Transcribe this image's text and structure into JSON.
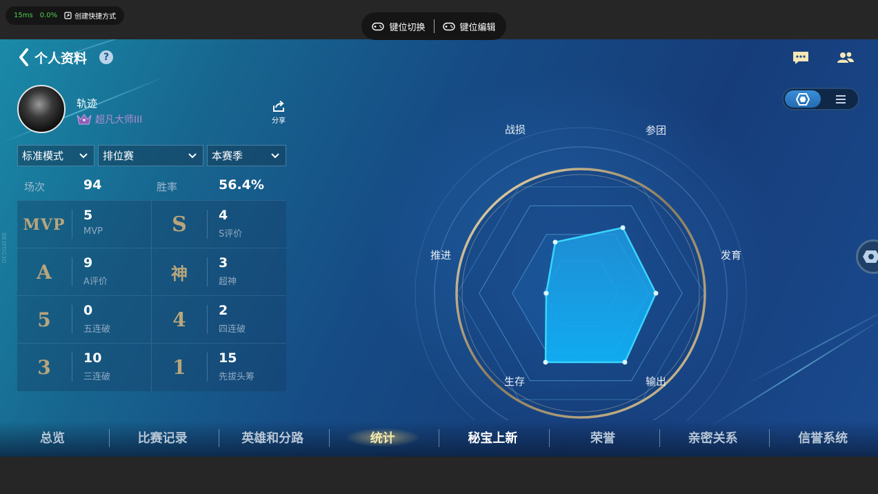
{
  "overlay": {
    "latency": "15ms",
    "loss": "0.0%",
    "shortcut_label": "创建快捷方式",
    "key_switch_label": "键位切换",
    "key_edit_label": "键位编辑"
  },
  "header": {
    "title": "个人资料",
    "help_symbol": "?"
  },
  "profile": {
    "name": "轨迹",
    "rank": "超凡大师III",
    "share_label": "分享"
  },
  "filters": {
    "mode": "标准模式",
    "match_type": "排位赛",
    "season": "本赛季"
  },
  "summary": {
    "matches_label": "场次",
    "matches_value": "94",
    "winrate_label": "胜率",
    "winrate_value": "56.4%"
  },
  "stats": [
    {
      "glyph": "MVP",
      "value": "5",
      "label": "MVP"
    },
    {
      "glyph": "S",
      "value": "4",
      "label": "S评价"
    },
    {
      "glyph": "A",
      "value": "9",
      "label": "A评价"
    },
    {
      "glyph": "神",
      "value": "3",
      "label": "超神"
    },
    {
      "glyph": "5",
      "value": "0",
      "label": "五连破"
    },
    {
      "glyph": "4",
      "value": "2",
      "label": "四连破"
    },
    {
      "glyph": "3",
      "value": "10",
      "label": "三连破"
    },
    {
      "glyph": "1",
      "value": "15",
      "label": "先拔头筹"
    }
  ],
  "side_id": "BB3FDG3D",
  "radar": {
    "labels": {
      "top_left": "战损",
      "top_right": "参团",
      "right": "发育",
      "bottom_right": "输出",
      "bottom_left": "生存",
      "left": "推进"
    }
  },
  "tabs": [
    "总览",
    "比赛记录",
    "英雄和分路",
    "统计",
    "秘宝上新",
    "荣誉",
    "亲密关系",
    "信誉系统"
  ],
  "active_tab": "统计",
  "colors": {
    "accent": "#1fb8ff",
    "gold": "#b8a57c",
    "active_tab": "#f2e9b0"
  }
}
